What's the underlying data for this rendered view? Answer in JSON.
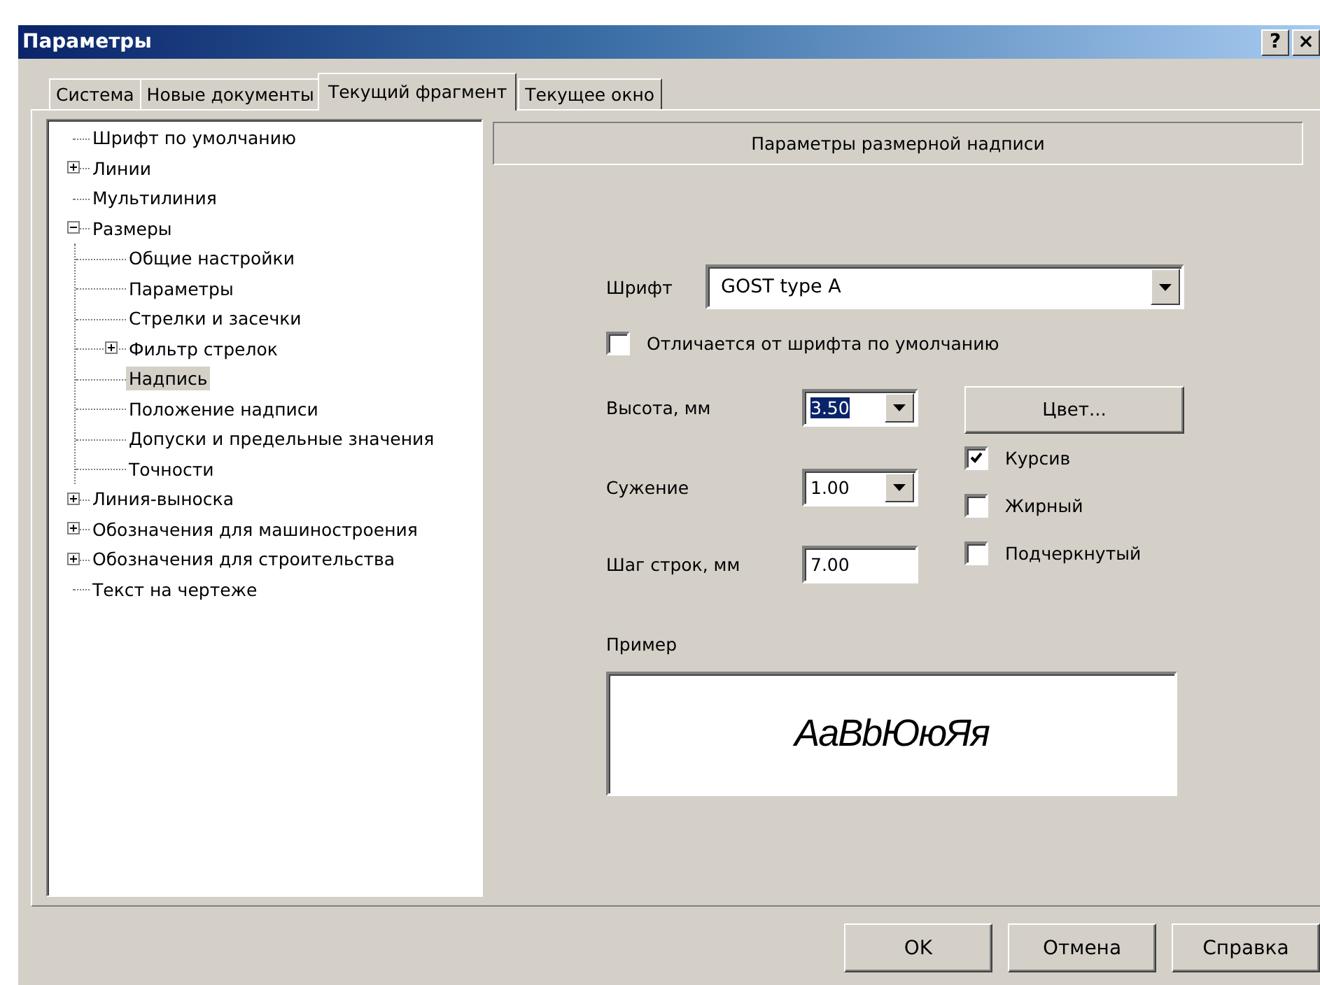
{
  "window": {
    "title": "Параметры",
    "title_buttons": [
      "?",
      "×"
    ]
  },
  "tabs": [
    {
      "label": "Система",
      "selected": false
    },
    {
      "label": "Новые документы",
      "selected": false
    },
    {
      "label": "Текущий фрагмент",
      "selected": true
    },
    {
      "label": "Текущее окно",
      "selected": false
    }
  ],
  "tree": [
    {
      "label": "Шрифт по умолчанию",
      "selected": false
    },
    {
      "label": "Линии",
      "selected": false,
      "expanded": false
    },
    {
      "label": "Мультилиния",
      "selected": false
    },
    {
      "label": "Размеры",
      "selected": false,
      "expanded": true,
      "children": [
        {
          "label": "Общие настройки",
          "selected": false
        },
        {
          "label": "Параметры",
          "selected": false
        },
        {
          "label": "Стрелки и засечки",
          "selected": false
        },
        {
          "label": "Фильтр стрелок",
          "selected": false,
          "expanded": false
        },
        {
          "label": "Надпись",
          "selected": true
        },
        {
          "label": "Положение надписи",
          "selected": false
        },
        {
          "label": "Допуски и предельные значения",
          "selected": false
        },
        {
          "label": "Точности",
          "selected": false
        }
      ]
    },
    {
      "label": "Линия-выноска",
      "selected": false,
      "expanded": false
    },
    {
      "label": "Обозначения для машиностроения",
      "selected": false,
      "expanded": false
    },
    {
      "label": "Обозначения для строительства",
      "selected": false,
      "expanded": false
    },
    {
      "label": "Текст на чертеже",
      "selected": false
    }
  ],
  "panel": {
    "header": "Параметры размерной надписи",
    "font": {
      "label": "Шрифт",
      "value": "GOST type A"
    },
    "differs": {
      "label": "Отличается от шрифта по умолчанию",
      "checked": false
    },
    "height": {
      "label": "Высота, мм",
      "value": "3.50",
      "text_selected": true
    },
    "narrowing": {
      "label": "Сужение",
      "value": "1.00"
    },
    "line_step": {
      "label": "Шаг строк, мм",
      "value": "7.00"
    },
    "color_button": "Цвет...",
    "styles": [
      {
        "label": "Курсив",
        "checked": true
      },
      {
        "label": "Жирный",
        "checked": false
      },
      {
        "label": "Подчеркнутый",
        "checked": false
      }
    ],
    "sample": {
      "label": "Пример",
      "text": "AaBbЮюЯя"
    }
  },
  "buttons": [
    "OK",
    "Отмена",
    "Справка"
  ]
}
